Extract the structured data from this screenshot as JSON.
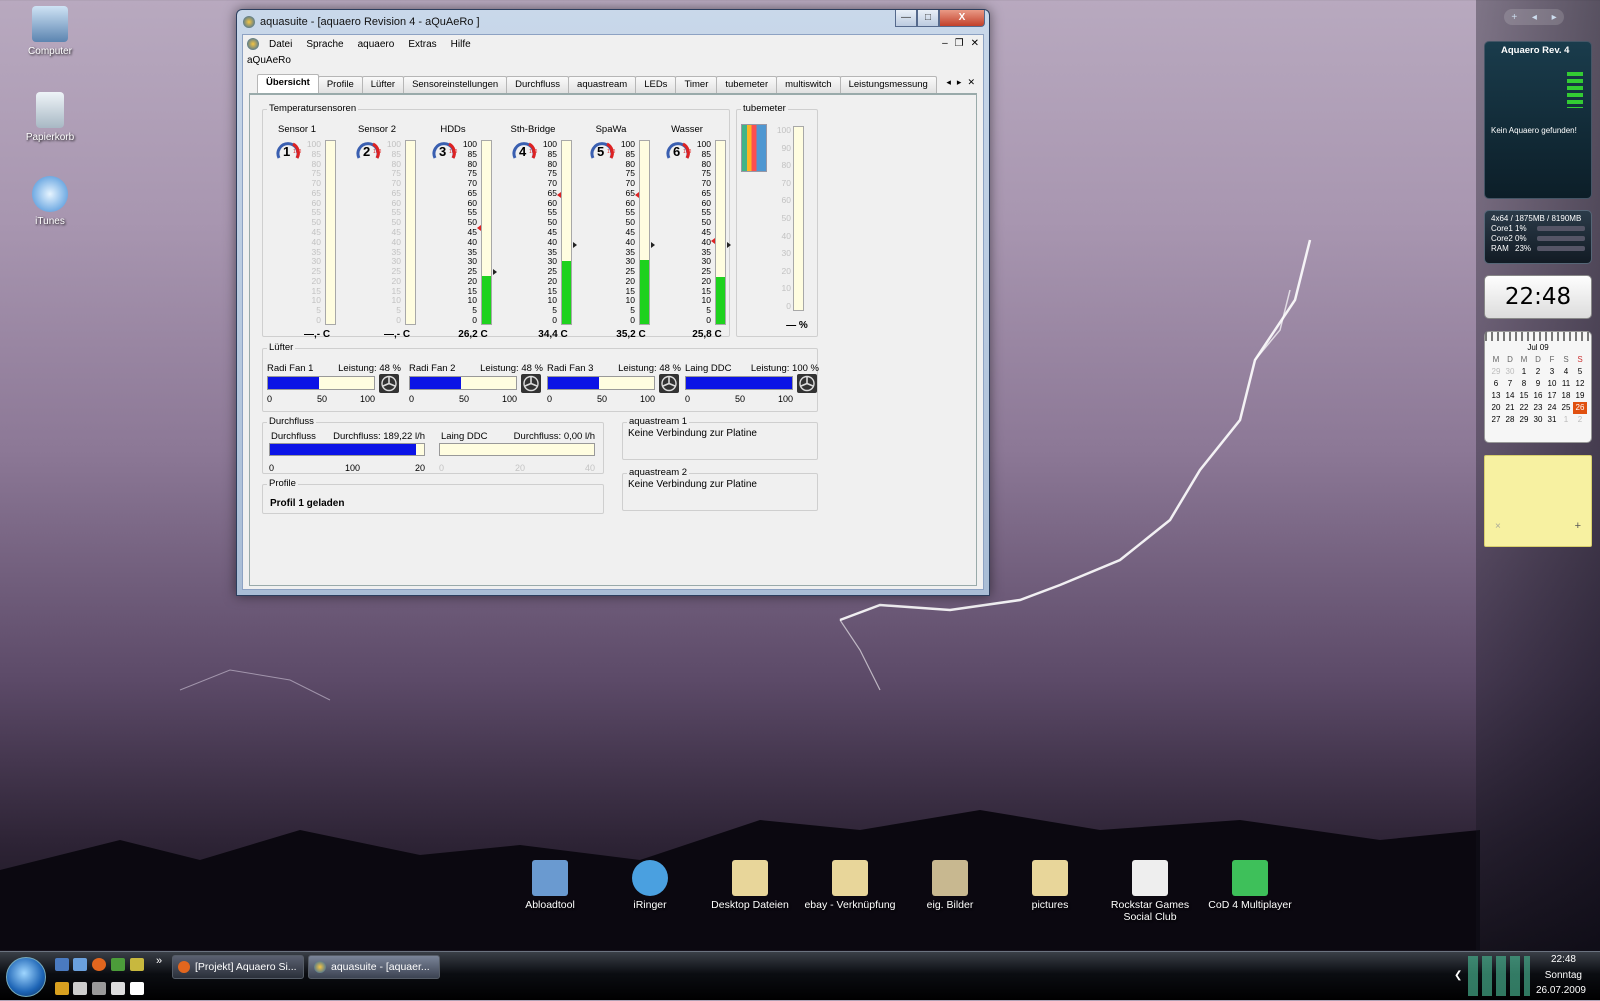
{
  "desktop": {
    "icons": [
      {
        "label": "Computer"
      },
      {
        "label": "Papierkorb"
      },
      {
        "label": "iTunes"
      }
    ],
    "shortcuts": [
      {
        "label": "Abloadtool"
      },
      {
        "label": "iRinger"
      },
      {
        "label": "Desktop Dateien"
      },
      {
        "label": "ebay - Verknüpfung"
      },
      {
        "label": "eig. Bilder"
      },
      {
        "label": "pictures"
      },
      {
        "label": "Rockstar Games Social Club"
      },
      {
        "label": "CoD 4 Multiplayer"
      }
    ]
  },
  "window": {
    "title": "aquasuite - [aquaero Revision 4 - aQuAeRo ]",
    "caption_buttons": {
      "minimize": "—",
      "maximize": "□",
      "close": "X"
    },
    "menu": [
      "Datei",
      "Sprache",
      "aquaero",
      "Extras",
      "Hilfe"
    ],
    "mdi_buttons": {
      "minimize": "–",
      "restore": "❐",
      "close": "✕"
    },
    "doc_name": "aQuAeRo",
    "tabs": [
      "Übersicht",
      "Profile",
      "Lüfter",
      "Sensoreinstellungen",
      "Durchfluss",
      "aquastream",
      "LEDs",
      "Timer",
      "tubemeter",
      "multiswitch",
      "Leistungsmessung"
    ],
    "active_tab": "Übersicht",
    "tab_nav": {
      "prev": "◂",
      "next": "▸",
      "close": "✕"
    }
  },
  "temperatures": {
    "group_title": "Temperatursensoren",
    "scale": [
      "100",
      "85",
      "80",
      "75",
      "70",
      "65",
      "60",
      "55",
      "50",
      "45",
      "40",
      "35",
      "30",
      "25",
      "20",
      "15",
      "10",
      "5",
      "0"
    ],
    "sensors": [
      {
        "name": "Sensor 1",
        "number": "1",
        "value": "—,- C",
        "level": 0,
        "active": false
      },
      {
        "name": "Sensor 2",
        "number": "2",
        "value": "—,- C",
        "level": 0,
        "active": false
      },
      {
        "name": "HDDs",
        "number": "3",
        "value": "26,2 C",
        "level": 0.262,
        "active": true
      },
      {
        "name": "Sth-Bridge",
        "number": "4",
        "value": "34,4 C",
        "level": 0.344,
        "active": true
      },
      {
        "name": "SpaWa",
        "number": "5",
        "value": "35,2 C",
        "level": 0.352,
        "active": true
      },
      {
        "name": "Wasser",
        "number": "6",
        "value": "25,8 C",
        "level": 0.258,
        "active": true
      }
    ],
    "gauge_max": "100"
  },
  "tubemeter": {
    "group_title": "tubemeter",
    "scale": [
      "100",
      "90",
      "80",
      "70",
      "60",
      "50",
      "40",
      "30",
      "20",
      "10",
      "0"
    ],
    "value": "— %"
  },
  "fans": {
    "group_title": "Lüfter",
    "items": [
      {
        "name": "Radi Fan 1",
        "perf": "Leistung: 48 %",
        "level": 0.48
      },
      {
        "name": "Radi Fan 2",
        "perf": "Leistung: 48 %",
        "level": 0.48
      },
      {
        "name": "Radi Fan 3",
        "perf": "Leistung: 48 %",
        "level": 0.48
      },
      {
        "name": "Laing DDC",
        "perf": "Leistung: 100 %",
        "level": 1.0
      }
    ],
    "scale": [
      "0",
      "50",
      "100"
    ]
  },
  "flow": {
    "group_title": "Durchfluss",
    "items": [
      {
        "name": "Durchfluss",
        "value": "Durchfluss: 189,22 l/h",
        "scale": [
          "0",
          "100",
          "20"
        ],
        "level": 0.95
      },
      {
        "name": "Laing DDC",
        "value": "Durchfluss: 0,00 l/h",
        "scale": [
          "0",
          "20",
          "40"
        ],
        "level": 0
      }
    ]
  },
  "profile": {
    "group_title": "Profile",
    "text": "Profil 1 geladen"
  },
  "aquastream": [
    {
      "title": "aquastream 1",
      "status": "Keine Verbindung zur Platine"
    },
    {
      "title": "aquastream 2",
      "status": "Keine Verbindung zur Platine"
    }
  ],
  "sidebar": {
    "top_controls": [
      "+",
      "◂",
      "▸"
    ],
    "aquaero_gadget": {
      "title": "Aquaero Rev. 4",
      "status": "Kein Aquaero gefunden!"
    },
    "cpu_gadget": {
      "header": "4x64 / 1875MB / 8190MB",
      "rows": [
        {
          "label": "Core1",
          "value": "1%"
        },
        {
          "label": "Core2",
          "value": "0%"
        },
        {
          "label": "RAM",
          "value": "23%"
        }
      ]
    },
    "clock": "22:48",
    "calendar": {
      "month": "Jul 09",
      "weekdays": [
        "M",
        "D",
        "M",
        "D",
        "F",
        "S",
        "S"
      ],
      "weeks": [
        [
          "29",
          "30",
          "1",
          "2",
          "3",
          "4",
          "5"
        ],
        [
          "6",
          "7",
          "8",
          "9",
          "10",
          "11",
          "12"
        ],
        [
          "13",
          "14",
          "15",
          "16",
          "17",
          "18",
          "19"
        ],
        [
          "20",
          "21",
          "22",
          "23",
          "24",
          "25",
          "26"
        ],
        [
          "27",
          "28",
          "29",
          "30",
          "31",
          "1",
          "2"
        ]
      ],
      "today": "26"
    },
    "note": {
      "close": "×",
      "add": "+"
    }
  },
  "taskbar": {
    "more": "»",
    "buttons": [
      {
        "label": "[Projekt] Aquaero Si..."
      },
      {
        "label": "aquasuite - [aquaer..."
      }
    ],
    "tray": {
      "expand": "❮",
      "time": "22:48",
      "day": "Sonntag",
      "date": "26.07.2009"
    }
  },
  "colors": {
    "fan_bar": "#0b13e6",
    "temp_fill": "#1ed21e",
    "tube_bg": "#fffde0",
    "today": "#e05010"
  }
}
